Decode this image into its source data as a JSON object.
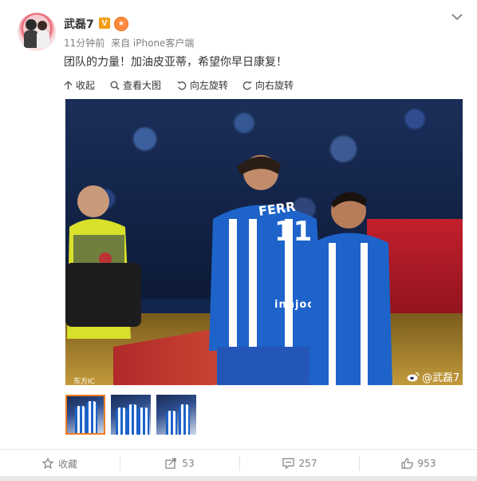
{
  "post": {
    "author": "武磊7",
    "verified_badge": "V",
    "time": "11分钟前",
    "source": "来自 iPhone客户端",
    "text": "团队的力量！加油皮亚蒂，希望你早日康复！"
  },
  "toolbar": {
    "collapse": "收起",
    "view_large": "查看大图",
    "rotate_left": "向左旋转",
    "rotate_right": "向右旋转"
  },
  "photo": {
    "watermark_left": "东方IC",
    "watermark_right": "@武磊7",
    "jersey_name": "FERR",
    "jersey_number": "11",
    "sponsor": "innjoo"
  },
  "thumbnails": [
    {
      "label": "thumbnail-1",
      "active": true
    },
    {
      "label": "thumbnail-2",
      "active": false
    },
    {
      "label": "thumbnail-3",
      "active": false
    }
  ],
  "footer": {
    "favorite": "收藏",
    "repost": "53",
    "comment": "257",
    "like": "953"
  },
  "colors": {
    "verified": "#f29c14",
    "active_thumb_border": "#f27c22",
    "text_gray": "#808080"
  }
}
